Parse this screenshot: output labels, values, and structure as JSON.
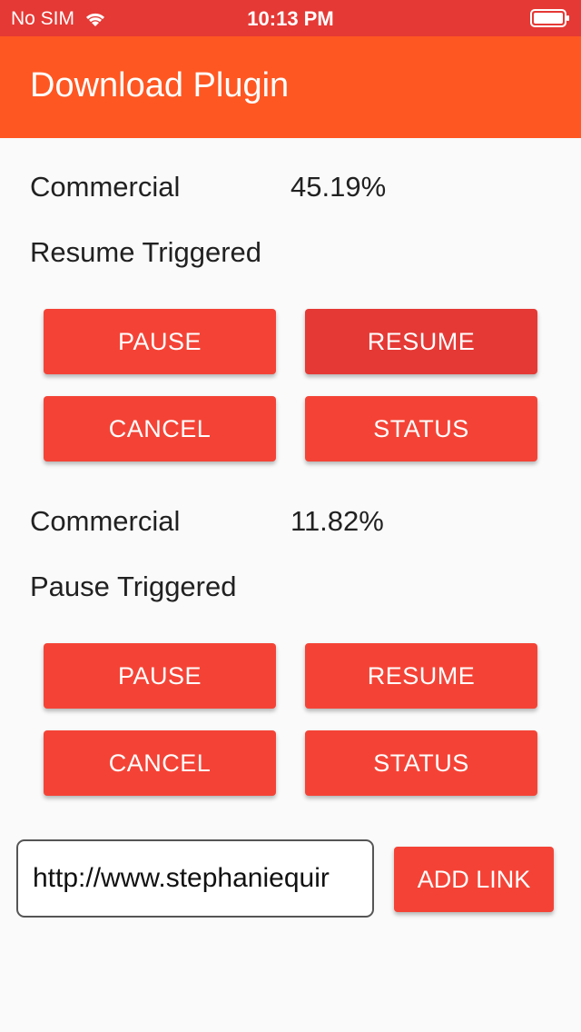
{
  "status_bar": {
    "carrier": "No SIM",
    "time": "10:13 PM",
    "wifi_icon": "wifi-icon",
    "battery_icon": "battery-icon"
  },
  "app_bar": {
    "title": "Download Plugin",
    "color": "#ff5722"
  },
  "downloads": [
    {
      "name": "Commercial",
      "progress": "45.19%",
      "status": "Resume Triggered",
      "buttons": {
        "pause": "PAUSE",
        "resume": "RESUME",
        "cancel": "CANCEL",
        "status": "STATUS"
      }
    },
    {
      "name": "Commercial",
      "progress": "11.82%",
      "status": "Pause Triggered",
      "buttons": {
        "pause": "PAUSE",
        "resume": "RESUME",
        "cancel": "CANCEL",
        "status": "STATUS"
      }
    }
  ],
  "add_link": {
    "input_value": "http://www.stephaniequir",
    "button_label": "ADD LINK"
  },
  "colors": {
    "status_bar": "#e53935",
    "button": "#f44336",
    "button_pressed": "#e53935"
  }
}
